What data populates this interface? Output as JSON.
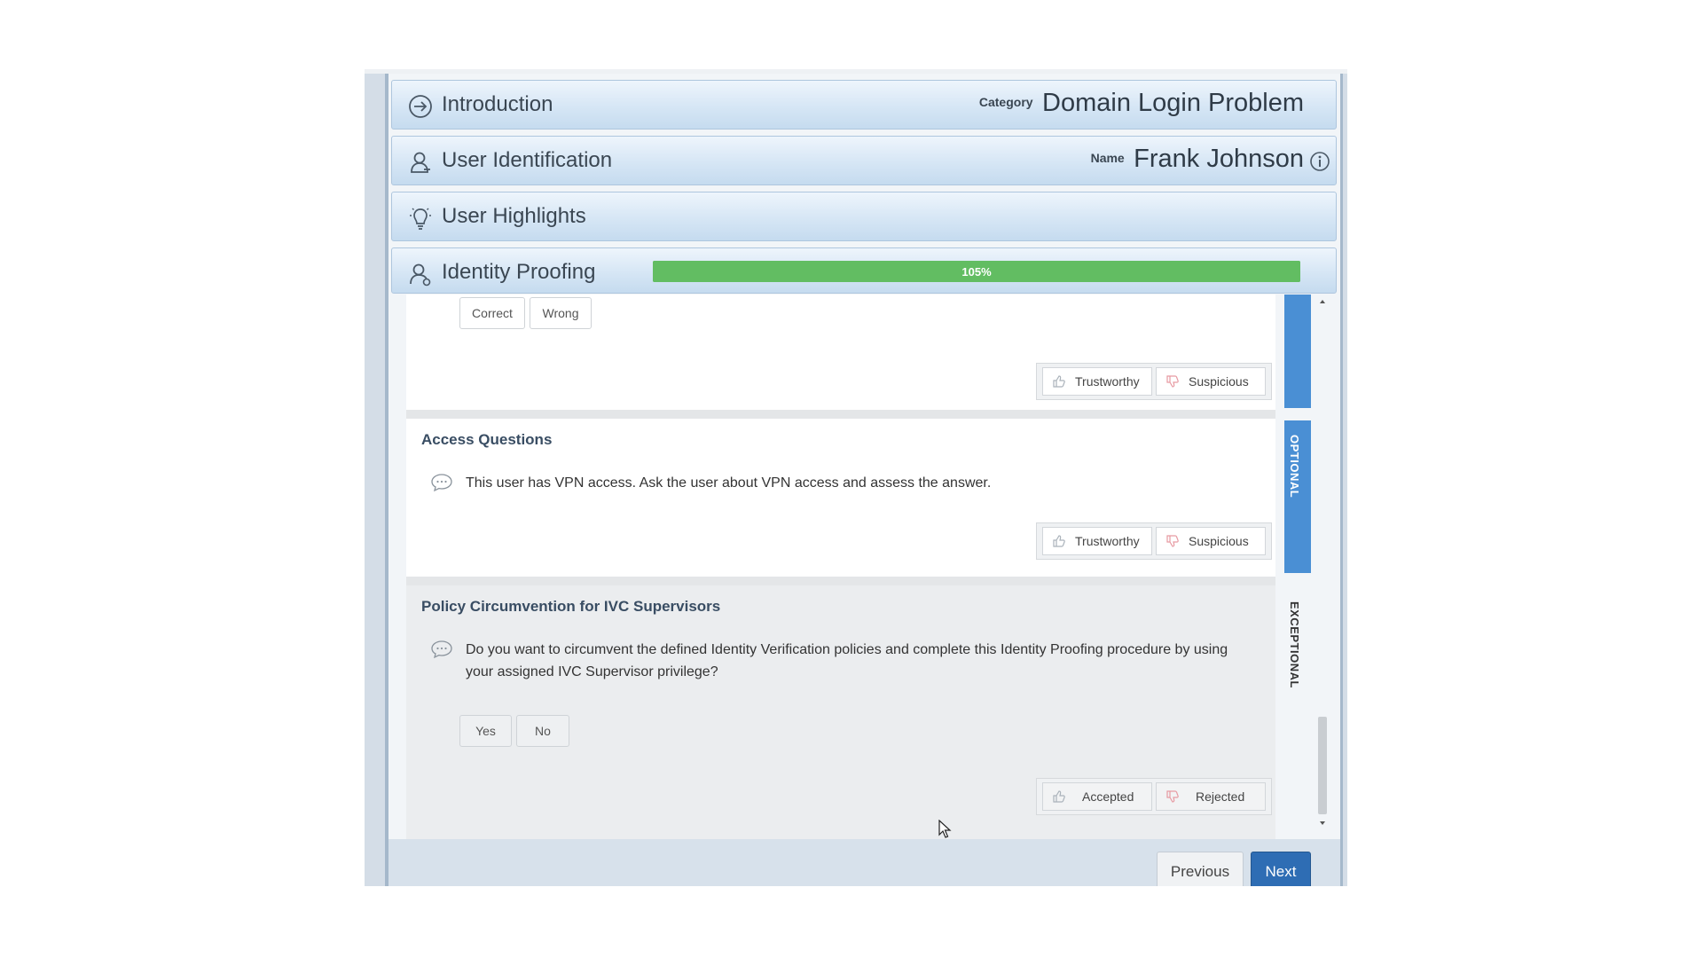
{
  "sections": {
    "introduction": {
      "title": "Introduction",
      "label": "Category",
      "value": "Domain Login Problem"
    },
    "user_identification": {
      "title": "User Identification",
      "label": "Name",
      "value": "Frank Johnson"
    },
    "user_highlights": {
      "title": "User Highlights"
    },
    "identity_proofing": {
      "title": "Identity Proofing",
      "progress_text": "105%",
      "progress_fraction": 1.0
    }
  },
  "cards": {
    "first": {
      "correct_label": "Correct",
      "wrong_label": "Wrong",
      "trustworthy_label": "Trustworthy",
      "suspicious_label": "Suspicious"
    },
    "access": {
      "title": "Access Questions",
      "question": "This user has VPN access. Ask the user about VPN access and assess the answer.",
      "trustworthy_label": "Trustworthy",
      "suspicious_label": "Suspicious",
      "tab_label": "OPTIONAL"
    },
    "policy": {
      "title": "Policy Circumvention for IVC Supervisors",
      "question": "Do you want to circumvent the defined Identity Verification policies and complete this Identity Proofing procedure by using your assigned IVC Supervisor privilege?",
      "yes_label": "Yes",
      "no_label": "No",
      "accepted_label": "Accepted",
      "rejected_label": "Rejected",
      "tab_label": "EXCEPTIONAL"
    }
  },
  "footer": {
    "previous_label": "Previous",
    "next_label": "Next"
  },
  "colors": {
    "progress": "#62bd62",
    "tab": "#4a8fd4",
    "next_button": "#2e6db4",
    "title_text": "#394d63"
  }
}
